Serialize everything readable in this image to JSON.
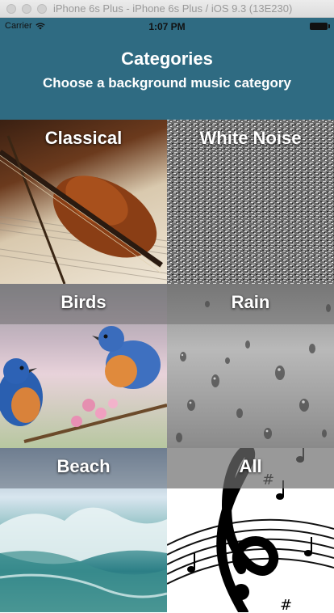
{
  "window": {
    "title": "iPhone 6s Plus - iPhone 6s Plus / iOS 9.3 (13E230)"
  },
  "status_bar": {
    "carrier": "Carrier",
    "time": "1:07 PM"
  },
  "header": {
    "title": "Categories",
    "subtitle": "Choose a background music category"
  },
  "categories": [
    {
      "label": "Classical",
      "image": "violin"
    },
    {
      "label": "White Noise",
      "image": "static-noise"
    },
    {
      "label": "Birds",
      "image": "bluebirds"
    },
    {
      "label": "Rain",
      "image": "raindrops-on-glass"
    },
    {
      "label": "Beach",
      "image": "ocean-wave"
    },
    {
      "label": "All",
      "image": "treble-clef-music-notes"
    }
  ],
  "colors": {
    "header_bg": "#2f6b82",
    "label_text": "#ffffff"
  }
}
